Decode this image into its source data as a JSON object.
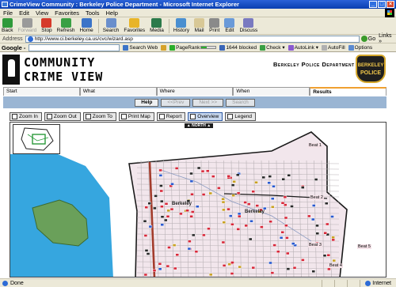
{
  "window": {
    "title": "CrimeView Community : Berkeley Police Department - Microsoft Internet Explorer",
    "minimize": "_",
    "maximize": "□",
    "close": "×"
  },
  "menu": [
    "File",
    "Edit",
    "View",
    "Favorites",
    "Tools",
    "Help"
  ],
  "toolbar": [
    {
      "label": "Back",
      "icon": "back-arrow-icon",
      "color": "#2f9a3a"
    },
    {
      "label": "Forward",
      "icon": "forward-arrow-icon",
      "color": "#9a9a9a",
      "disabled": true
    },
    {
      "label": "Stop",
      "icon": "stop-icon",
      "color": "#d63a2a"
    },
    {
      "label": "Refresh",
      "icon": "refresh-icon",
      "color": "#3aa044"
    },
    {
      "label": "Home",
      "icon": "home-icon",
      "color": "#3b74c8"
    },
    {
      "label": "Search",
      "icon": "search-icon",
      "color": "#6a8fcc"
    },
    {
      "label": "Favorites",
      "icon": "favorites-star-icon",
      "color": "#e8b428"
    },
    {
      "label": "Media",
      "icon": "media-icon",
      "color": "#2c7a4a"
    },
    {
      "label": "History",
      "icon": "history-icon",
      "color": "#4a8fd0"
    },
    {
      "label": "Mail",
      "icon": "mail-icon",
      "color": "#d8c896"
    },
    {
      "label": "Print",
      "icon": "print-icon",
      "color": "#8a8a8a"
    },
    {
      "label": "Edit",
      "icon": "edit-icon",
      "color": "#6a9ad8"
    },
    {
      "label": "Discuss",
      "icon": "discuss-icon",
      "color": "#7a7ac0"
    }
  ],
  "address": {
    "label": "Address",
    "url": "http://www.ci.berkeley.ca.us/cvc/wizard.asp",
    "go": "Go",
    "links": "Links »"
  },
  "google_bar": {
    "logo": "Google -",
    "items": [
      {
        "label": "Search Web",
        "color": "#3b74c8"
      },
      {
        "label": "",
        "color": "#d6a22a"
      },
      {
        "label": "PageRank",
        "color": "#2bae2b"
      },
      {
        "label": "1644 blocked",
        "color": "#3a66b8"
      },
      {
        "label": "Check ▾",
        "color": "#3aa044"
      },
      {
        "label": "AutoLink ▾",
        "color": "#8a5ad0"
      },
      {
        "label": "AutoFill",
        "color": "#b0b0b0"
      },
      {
        "label": "Options",
        "color": "#5a8ad0"
      }
    ]
  },
  "site": {
    "title_line1": "COMMUNITY",
    "title_line2": "CRIME VIEW",
    "department": "Berkeley Police Department",
    "badge_top": "BERKELEY",
    "badge_bottom": "POLICE"
  },
  "tabs": [
    "Start",
    "What",
    "Where",
    "When",
    "Results"
  ],
  "wizard_buttons": [
    {
      "label": "Help",
      "kind": "help"
    },
    {
      "label": "<<Prev",
      "kind": "disabled"
    },
    {
      "label": "Next >>",
      "kind": "disabled"
    },
    {
      "label": "Search",
      "kind": "disabled"
    }
  ],
  "map_tools": [
    "Zoom In",
    "Zoom Out",
    "Zoom To",
    "Print Map",
    "Report",
    "Overview",
    "Legend"
  ],
  "map": {
    "north_label": "▲ NORTH ▲",
    "beat_labels": [
      "Beat 1",
      "Beat 2",
      "Beat 3",
      "Beat 4",
      "Beat 5"
    ],
    "area_labels": [
      "Berkeley",
      "Berkeley"
    ],
    "colors": {
      "water": "#36a6df",
      "land": "#ffffff",
      "district": "#f2e6ec",
      "park": "#6aa05a",
      "major_road": "#a33c2c",
      "boundary": "#1a1a1a"
    }
  },
  "status": {
    "text": "Done",
    "zone": "Internet"
  }
}
